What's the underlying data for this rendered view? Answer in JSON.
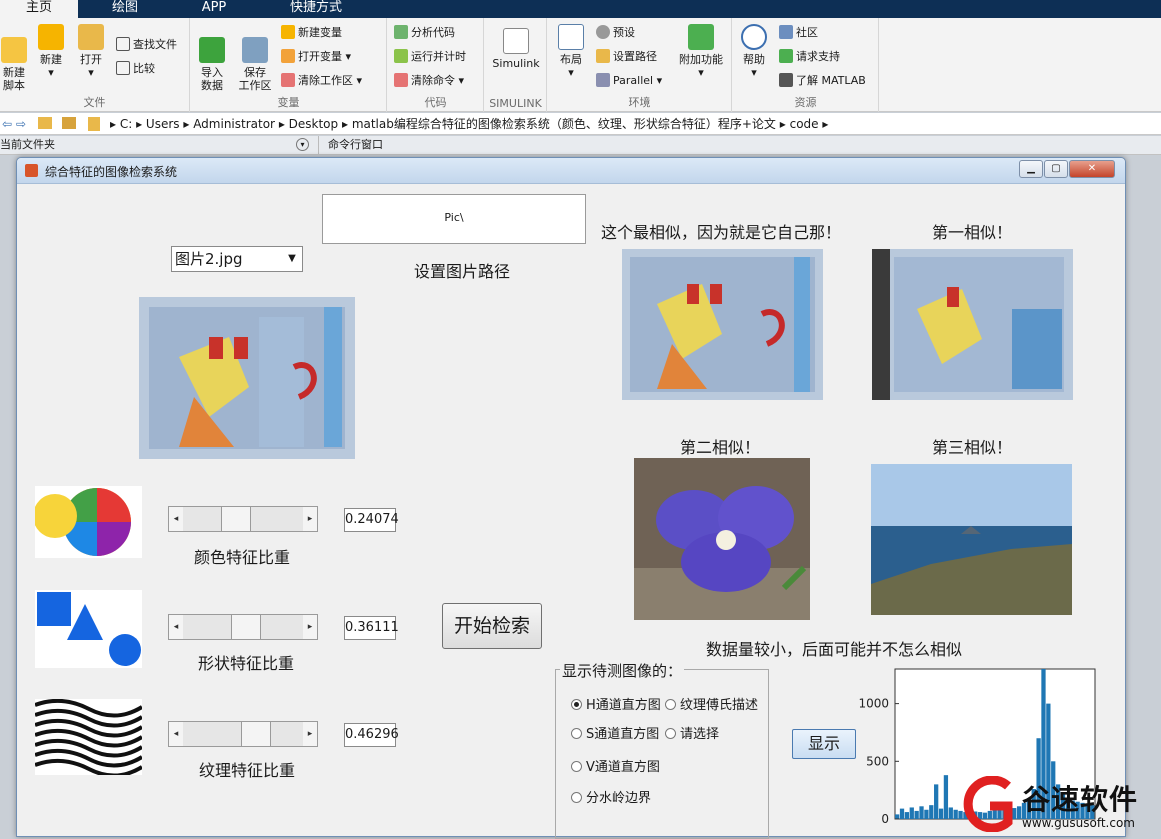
{
  "ribbon_tabs": [
    "主页",
    "绘图",
    "APP",
    "快捷方式"
  ],
  "ribbon": {
    "file": {
      "label": "文件",
      "new_script": "新建\n脚本",
      "new": "新建",
      "open": "打开",
      "find_files": "查找文件",
      "compare": "比较"
    },
    "variable": {
      "label": "变量",
      "import": "导入\n数据",
      "save_ws": "保存\n工作区",
      "new_var": "新建变量",
      "open_var": "打开变量",
      "clear_ws": "清除工作区"
    },
    "code": {
      "label": "代码",
      "analyze": "分析代码",
      "run_time": "运行并计时",
      "clear_cmd": "清除命令"
    },
    "simulink": {
      "label": "SIMULINK",
      "simulink": "Simulink"
    },
    "env": {
      "label": "环境",
      "layout": "布局",
      "prefs": "预设",
      "set_path": "设置路径",
      "parallel": "Parallel",
      "addons": "附加功能"
    },
    "resources": {
      "label": "资源",
      "help": "帮助",
      "community": "社区",
      "support": "请求支持",
      "learn": "了解 MATLAB"
    }
  },
  "address": {
    "path": [
      "C:",
      "Users",
      "Administrator",
      "Desktop",
      "matlab编程综合特征的图像检索系统（颜色、纹理、形状综合特征）程序+论文",
      "code"
    ]
  },
  "panels": {
    "current_folder": "当前文件夹",
    "command_window": "命令行窗口"
  },
  "window": {
    "title": "综合特征的图像检索系统",
    "path_box": "Pic\\",
    "path_label": "设置图片路径",
    "dropdown_value": "图片2.jpg",
    "most_similar_caption": "这个最相似，因为就是它自己那！",
    "first_caption": "第一相似！",
    "second_caption": "第二相似！",
    "third_caption": "第三相似！",
    "note": "数据量较小，后面可能并不怎么相似",
    "search_button": "开始检索",
    "color_weight_label": "颜色特征比重",
    "shape_weight_label": "形状特征比重",
    "texture_weight_label": "纹理特征比重",
    "color_weight_value": "0.24074",
    "shape_weight_value": "0.36111",
    "texture_weight_value": "0.46296",
    "color_weight": 0.24074,
    "shape_weight": 0.36111,
    "texture_weight": 0.46296,
    "display_group_title": "显示待测图像的：",
    "radio_h": "H通道直方图",
    "radio_s": "S通道直方图",
    "radio_v": "V通道直方图",
    "radio_watershed": "分水岭边界",
    "radio_fourier": "纹理傅氏描述",
    "radio_choose": "请选择",
    "show_button": "显示"
  },
  "chart_data": {
    "type": "bar",
    "title": "",
    "xlabel": "",
    "ylabel": "",
    "yticks": [
      0,
      500,
      1000
    ],
    "ylim": [
      0,
      1300
    ],
    "color": "#1f77b4",
    "x": [
      0,
      5,
      10,
      15,
      20,
      25,
      30,
      35,
      40,
      45,
      50,
      55,
      60,
      65,
      70,
      75,
      80,
      85,
      90,
      95,
      100,
      105,
      110,
      115,
      120,
      125,
      130,
      135,
      140,
      145,
      150,
      155,
      160,
      165,
      170,
      175,
      180,
      185,
      190,
      195,
      200
    ],
    "values": [
      40,
      90,
      60,
      100,
      70,
      110,
      80,
      120,
      300,
      90,
      380,
      100,
      80,
      70,
      60,
      75,
      65,
      60,
      55,
      70,
      80,
      90,
      85,
      80,
      95,
      110,
      140,
      180,
      260,
      700,
      1300,
      1000,
      500,
      300,
      220,
      180,
      160,
      150,
      140,
      130,
      120
    ]
  },
  "watermark": {
    "brand": "谷速软件",
    "url": "www.gususoft.com"
  },
  "colors": {
    "ribbon_dark": "#0d2f55",
    "accent": "#1f77b4"
  }
}
